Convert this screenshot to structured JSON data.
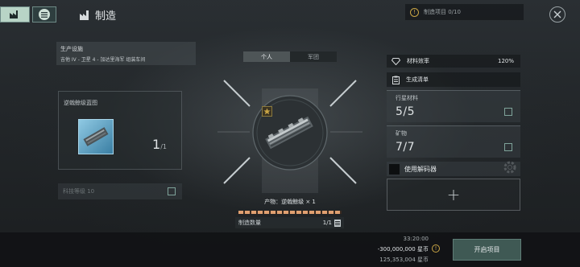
{
  "header": {
    "title": "制造",
    "project_slots": "制造项目 0/10"
  },
  "facility": {
    "label": "生产设施",
    "location": "吉他 IV - 卫星 4 - 加达里海军 组装车间"
  },
  "blueprint": {
    "name": "逆戟鲸级蓝图",
    "runs": "1",
    "runs_total": "/1",
    "tech_level": "科技等级 10"
  },
  "tabs": [
    {
      "label": "个人",
      "active": true
    },
    {
      "label": "军团",
      "active": false
    }
  ],
  "product": {
    "text": "产物：逆戟鲸级 × 1",
    "quantity_label": "制造数量",
    "quantity": "1/1"
  },
  "right": {
    "efficiency_label": "材料效率",
    "efficiency_value": "120%",
    "bom_label": "生成清单",
    "planetary_label": "行星材料",
    "planetary_value": "5/5",
    "mineral_label": "矿物",
    "mineral_value": "7/7",
    "decoder_label": "使用解码器",
    "add_symbol": "+"
  },
  "footer": {
    "time": "33:20:00",
    "cost": "-300,000,000 星币",
    "balance": "125,353,004 星币",
    "start_button": "开启项目"
  },
  "colors": {
    "accent": "#7fa39a",
    "start_button": "#3f5954",
    "warning": "#c9a545"
  }
}
